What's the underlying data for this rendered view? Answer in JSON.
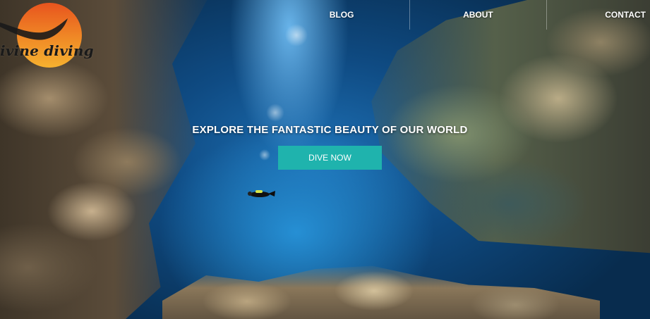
{
  "brand": {
    "name": "ivine diving",
    "logo_colors": {
      "sun_top": "#e8541e",
      "sun_bottom": "#f6b12f",
      "ray": "#1a1a1a"
    }
  },
  "nav": {
    "items": [
      {
        "label": "BLOG"
      },
      {
        "label": "ABOUT"
      },
      {
        "label": "CONTACT"
      }
    ]
  },
  "hero": {
    "headline": "EXPLORE THE FANTASTIC BEAUTY OF OUR WORLD",
    "cta_label": "DIVE NOW",
    "cta_color": "#1fb3ad",
    "background": "underwater-canyon-with-diver"
  }
}
